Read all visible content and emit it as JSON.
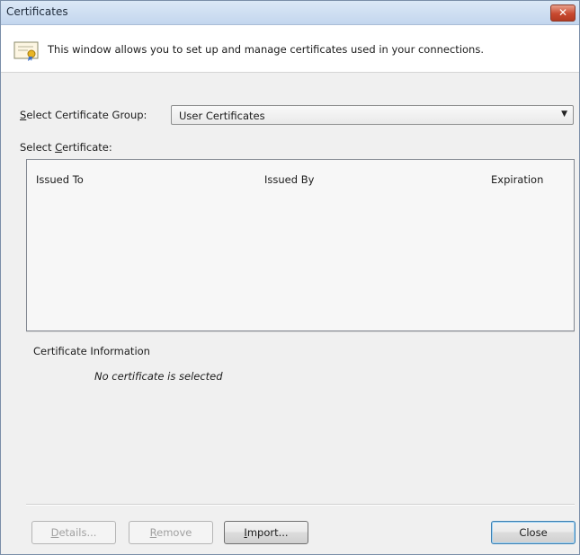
{
  "window": {
    "title": "Certificates"
  },
  "info": {
    "text": "This window allows you to set up and manage certificates used in your connections."
  },
  "group": {
    "label": "Select Certificate Group:",
    "value": "User Certificates"
  },
  "certificate_list": {
    "label": "Select Certificate:",
    "columns": [
      "Issued To",
      "Issued By",
      "Expiration"
    ],
    "rows": []
  },
  "certificate_info": {
    "heading": "Certificate Information",
    "empty_text": "No certificate is selected"
  },
  "buttons": {
    "details": "Details...",
    "remove": "Remove",
    "import": "Import...",
    "close": "Close"
  }
}
